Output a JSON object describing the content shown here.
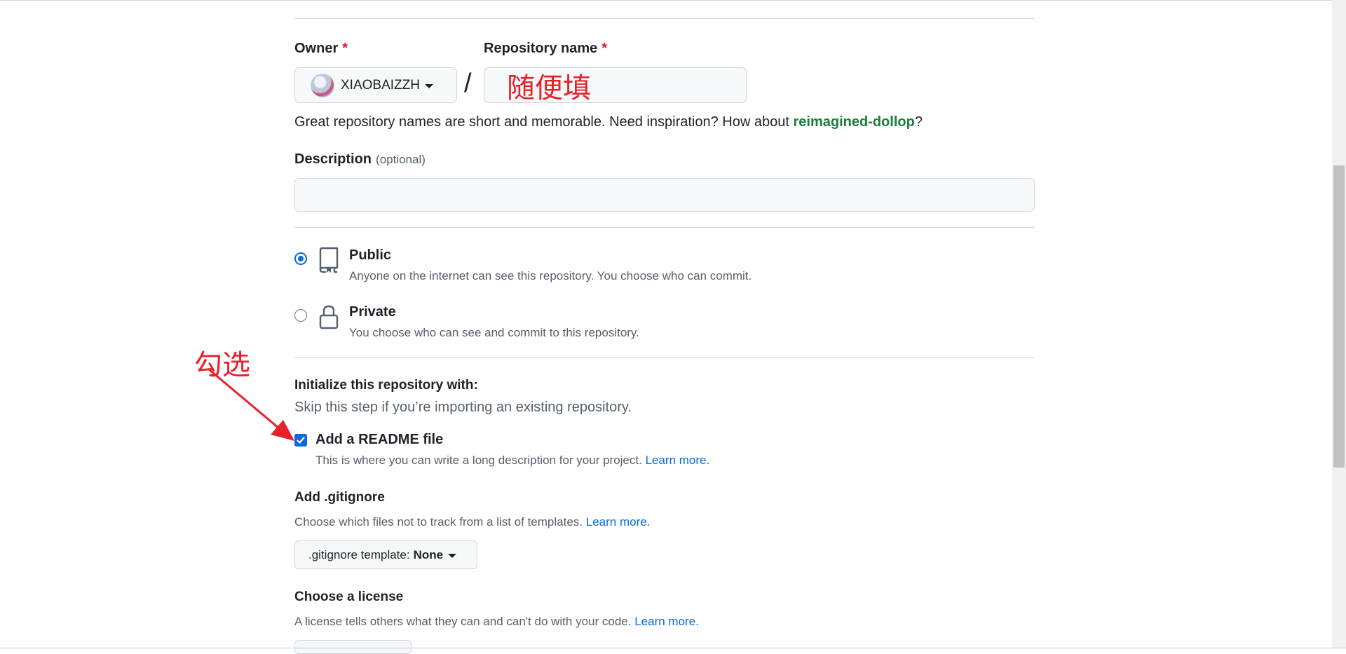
{
  "owner": {
    "label": "Owner",
    "required_mark": "*",
    "value": "XIAOBAIZZH"
  },
  "slash": "/",
  "repo_name": {
    "label": "Repository name",
    "required_mark": "*",
    "value": "随便填"
  },
  "name_hint": {
    "text": "Great repository names are short and memorable. Need inspiration? How about ",
    "suggestion": "reimagined-dollop",
    "suffix": "?"
  },
  "description": {
    "label": "Description",
    "optional": "(optional)",
    "value": ""
  },
  "visibility": {
    "selected": "Public",
    "options": [
      {
        "title": "Public",
        "subtitle": "Anyone on the internet can see this repository. You choose who can commit.",
        "icon": "repo-icon"
      },
      {
        "title": "Private",
        "subtitle": "You choose who can see and commit to this repository.",
        "icon": "lock-icon"
      }
    ]
  },
  "init": {
    "heading": "Initialize this repository with:",
    "subheading": "Skip this step if you’re importing an existing repository.",
    "readme": {
      "checked": true,
      "label": "Add a README file",
      "description": "This is where you can write a long description for your project.",
      "link": "Learn more."
    }
  },
  "gitignore": {
    "heading": "Add .gitignore",
    "description": "Choose which files not to track from a list of templates.",
    "link": "Learn more.",
    "select_prefix": ".gitignore template:",
    "select_value": "None"
  },
  "license": {
    "heading": "Choose a license",
    "description": "A license tells others what they can and can't do with your code.",
    "link": "Learn more."
  },
  "annotation": {
    "text": "勾选",
    "color": "#e8202a"
  },
  "colors": {
    "accent": "#0969da",
    "suggestion": "#1a7f37",
    "required": "#cf222e",
    "annotation": "#e8202a"
  }
}
